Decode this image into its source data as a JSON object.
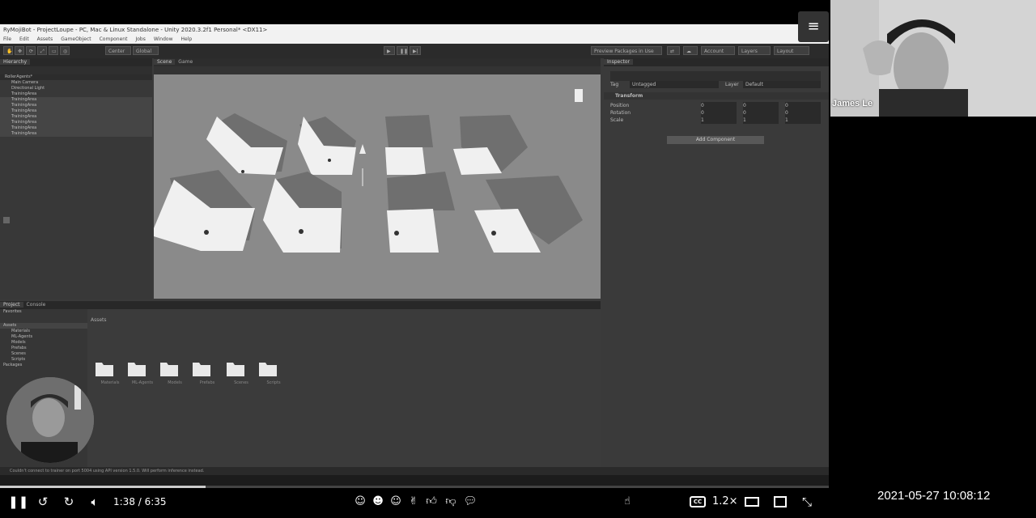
{
  "unity": {
    "window_title": "RyMojiBot - ProjectLoupe - PC, Mac & Linux Standalone - Unity 2020.3.2f1 Personal* <DX11>",
    "menu": [
      "File",
      "Edit",
      "Assets",
      "GameObject",
      "Component",
      "Jobs",
      "Window",
      "Help"
    ],
    "toolbar": {
      "center_label": "Center",
      "global_label": "Global",
      "preview_packages_label": "Preview Packages in Use",
      "account_label": "Account",
      "layers_label": "Layers",
      "layout_label": "Layout"
    },
    "hierarchy": {
      "tab": "Hierarchy",
      "items": [
        "RollerAgents*",
        "Main Camera",
        "Directional Light",
        "TrainingArea",
        "TrainingArea",
        "TrainingArea",
        "TrainingArea",
        "TrainingArea",
        "TrainingArea",
        "TrainingArea",
        "TrainingArea"
      ]
    },
    "scene_tabs": [
      "Scene",
      "Game"
    ],
    "inspector": {
      "tab": "Inspector",
      "tag_label": "Tag",
      "tag_value": "Untagged",
      "layer_label": "Layer",
      "layer_value": "Default",
      "component": "Transform",
      "rows": [
        {
          "label": "Position",
          "x": "0",
          "y": "0",
          "z": "0"
        },
        {
          "label": "Rotation",
          "x": "0",
          "y": "0",
          "z": "0"
        },
        {
          "label": "Scale",
          "x": "1",
          "y": "1",
          "z": "1"
        }
      ],
      "add_component": "Add Component"
    },
    "project": {
      "tabs": [
        "Project",
        "Console"
      ],
      "favorites_label": "Favorites",
      "assets_label": "Assets",
      "tree": [
        "Assets",
        "Materials",
        "ML-Agents",
        "Models",
        "Prefabs",
        "Scenes",
        "Scripts",
        "Packages"
      ],
      "folders": [
        "Materials",
        "ML-Agents",
        "Models",
        "Prefabs",
        "Scenes",
        "Scripts"
      ]
    },
    "status_message": "Couldn't connect to trainer on port 5004 using API version 1.5.0. Will perform inference instead."
  },
  "player": {
    "time_current": "1:38",
    "time_total": "6:35",
    "time_display": "1:38 / 6:35",
    "progress": 0.248,
    "speed": "1.2×",
    "cc_label": "CC",
    "icons": [
      "pause-icon",
      "rewind-icon",
      "forward-icon",
      "volume-icon",
      "reaction-icons",
      "thumbs-up-icon",
      "thumbs-down-icon",
      "comment-icon",
      "cc-icon",
      "theater-icon",
      "pip-icon",
      "fullscreen-exit-icon"
    ]
  },
  "webcam": {
    "name": "James Le"
  },
  "timestamp": "2021-05-27  10:08:12",
  "menu_icon": "hamburger-icon"
}
